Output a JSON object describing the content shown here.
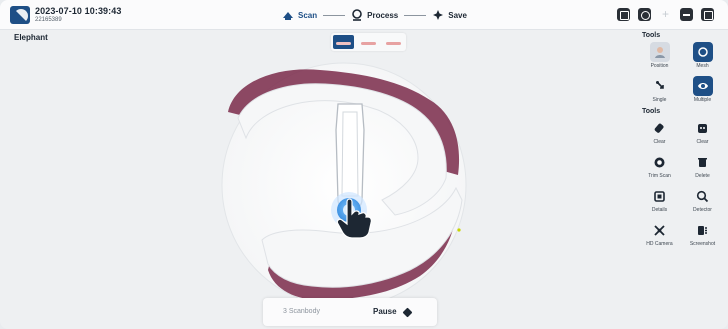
{
  "header": {
    "datetime": "2023-07-10 10:39:43",
    "session_id": "22165389",
    "steps": [
      {
        "label": "Scan",
        "icon": "scan-icon",
        "active": true
      },
      {
        "label": "Process",
        "icon": "process-icon",
        "active": false
      },
      {
        "label": "Save",
        "icon": "save-icon",
        "active": false
      }
    ],
    "top_icons": [
      "window-icon",
      "record-icon",
      "plus-icon",
      "minimize-icon",
      "close-icon"
    ]
  },
  "patient": {
    "name": "Elephant"
  },
  "view_modes": [
    "view-mode-1",
    "view-mode-2",
    "view-mode-3"
  ],
  "tools": {
    "section1_title": "Tools",
    "section1": [
      {
        "label": "Position",
        "icon": "position-photo-icon"
      },
      {
        "label": "Mesh",
        "icon": "mesh-icon"
      },
      {
        "label": "Single",
        "icon": "single-icon"
      },
      {
        "label": "Multiple",
        "icon": "multiple-icon"
      }
    ],
    "section2_title": "Tools",
    "section2": [
      {
        "label": "Clear",
        "icon": "eraser-icon"
      },
      {
        "label": "Clear",
        "icon": "clear-face-icon"
      },
      {
        "label": "Trim Scan",
        "icon": "trim-scan-icon"
      },
      {
        "label": "Delete",
        "icon": "delete-icon"
      },
      {
        "label": "Details",
        "icon": "details-icon"
      },
      {
        "label": "Detector",
        "icon": "detector-icon"
      },
      {
        "label": "HD Camera",
        "icon": "hd-camera-icon"
      },
      {
        "label": "Screenshot",
        "icon": "screenshot-icon"
      }
    ]
  },
  "bottom": {
    "scanbody_label": "3 Scanbody",
    "pause_label": "Pause"
  },
  "colors": {
    "accent": "#1e4f86",
    "gingiva": "#7a2a4a",
    "tooth": "#f4f5f6"
  }
}
